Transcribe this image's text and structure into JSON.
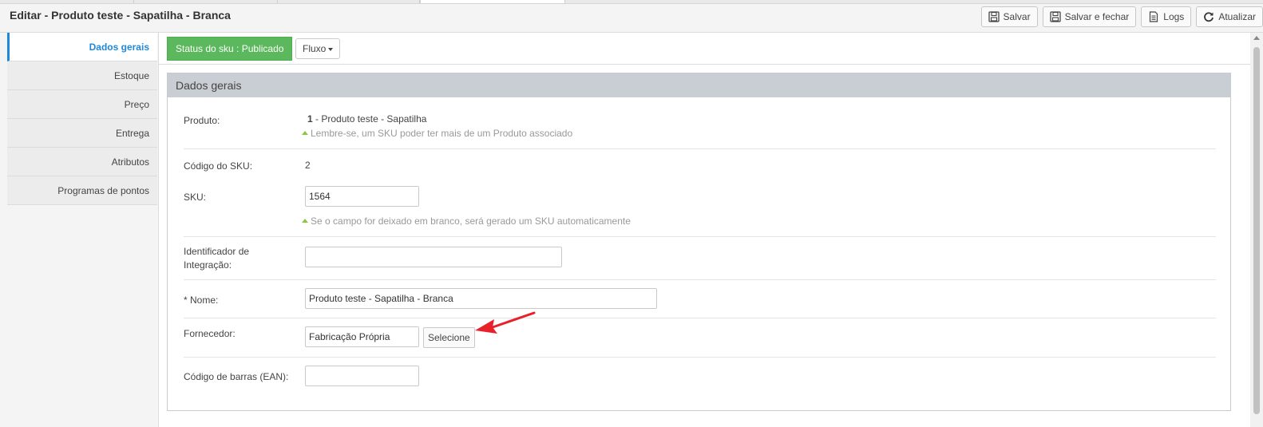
{
  "header": {
    "title": "Editar - Produto teste - Sapatilha - Branca",
    "buttons": {
      "save": "Salvar",
      "save_close": "Salvar e fechar",
      "logs": "Logs",
      "refresh": "Atualizar"
    }
  },
  "sidebar": {
    "items": [
      {
        "label": "Dados gerais"
      },
      {
        "label": "Estoque"
      },
      {
        "label": "Preço"
      },
      {
        "label": "Entrega"
      },
      {
        "label": "Atributos"
      },
      {
        "label": "Programas de pontos"
      }
    ]
  },
  "actions": {
    "status": "Status do sku : Publicado",
    "flow": "Fluxo"
  },
  "panel": {
    "title": "Dados gerais",
    "produto": {
      "label": "Produto:",
      "id": "1",
      "name": "- Produto teste - Sapatilha",
      "hint": "Lembre-se, um SKU poder ter mais de um Produto associado"
    },
    "codigo_sku": {
      "label": "Código do SKU:",
      "value": "2"
    },
    "sku": {
      "label": "SKU:",
      "value": "1564",
      "hint": "Se o campo for deixado em branco, será gerado um SKU automaticamente"
    },
    "identificador": {
      "label_line1": "Identificador de",
      "label_line2": "Integração:",
      "value": ""
    },
    "nome": {
      "label": "* Nome:",
      "value": "Produto teste - Sapatilha - Branca"
    },
    "fornecedor": {
      "label": "Fornecedor:",
      "value": "Fabricação Própria",
      "button": "Selecione"
    },
    "ean": {
      "label": "Código de barras (EAN):",
      "value": ""
    }
  },
  "colors": {
    "accent": "#1e88d9",
    "status_green": "#5cb85c",
    "hint_arrow": "#8dc63f",
    "annotation_arrow": "#e8202a"
  }
}
